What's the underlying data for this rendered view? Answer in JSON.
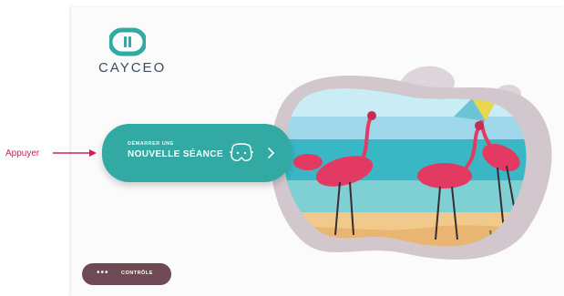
{
  "annotation": {
    "label": "Appuyer",
    "color": "#c8264f"
  },
  "logo": {
    "text": "CAYCEO",
    "icon": "cayceo-logo-icon",
    "color": "#32aaa3"
  },
  "start_session": {
    "small_label": "DÉMARRER UNE",
    "main_label": "NOUVELLE SÉANCE",
    "icon": "vr-headset-icon",
    "chevron": "chevron-right-icon",
    "color": "#32aaa3"
  },
  "control": {
    "dots": "•••",
    "label": "CONTRÔLE",
    "color": "#6e4a54"
  },
  "illustration": {
    "subject": "flamingos-illustration"
  }
}
